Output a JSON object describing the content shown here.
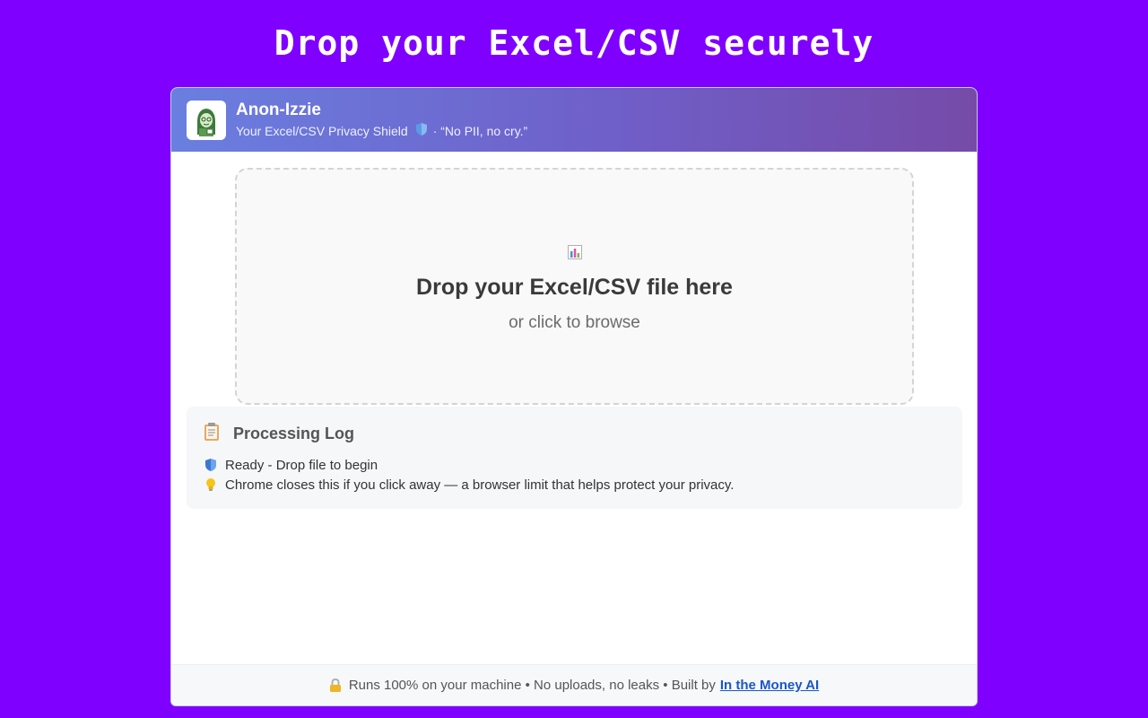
{
  "hero": {
    "title": "Drop your Excel/CSV securely"
  },
  "header": {
    "app_name": "Anon-Izzie",
    "subtitle_main": "Your Excel/CSV Privacy Shield",
    "subtitle_tag": "· “No PII, no cry.”",
    "logo_icon": "woman-portrait-icon"
  },
  "dropzone": {
    "icon": "bar-chart-icon",
    "title": "Drop your Excel/CSV file here",
    "subtitle": "or click to browse"
  },
  "log": {
    "icon": "clipboard-icon",
    "title": "Processing Log",
    "lines": [
      {
        "icon": "shield-icon",
        "text": "Ready - Drop file to begin"
      },
      {
        "icon": "lightbulb-icon",
        "text": "Chrome closes this if you click away — a browser limit that helps protect your privacy."
      }
    ]
  },
  "footer": {
    "icon": "lock-icon",
    "text": "Runs 100% on your machine • No uploads, no leaks • Built by",
    "link_label": "In the Money AI"
  },
  "colors": {
    "background": "#7f00ff",
    "header_start": "#6a7fe0",
    "header_end": "#764ba8",
    "link": "#1a56c8"
  }
}
